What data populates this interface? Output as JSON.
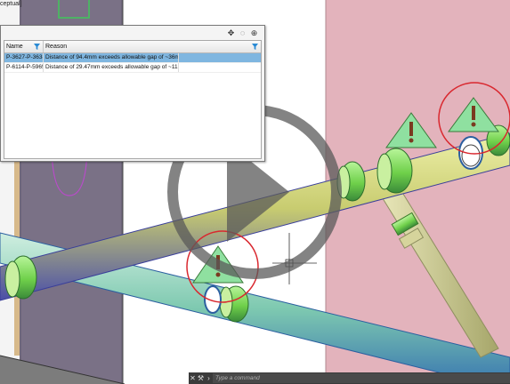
{
  "viewport": {
    "view_label": "ceptual]"
  },
  "panel": {
    "toolbar_icons": [
      "move-icon",
      "lasso-icon",
      "zoom-icon"
    ],
    "columns": [
      "Name",
      "Reason"
    ],
    "rows": [
      {
        "name": "P-3627-P-3638",
        "reason": "Distance of 94.4mm exceeds allowable gap of ~36mm"
      },
      {
        "name": "P-6114-P-5965",
        "reason": "Distance of 29.47mm exceeds allowable gap of ~11mm"
      }
    ]
  },
  "command_line": {
    "placeholder": "Type a command"
  },
  "colors": {
    "selection": "#7fb6e0",
    "wall_pink": "#e3b3bc",
    "pipe_green": "#7ed957",
    "warning_green": "#8fe0a0",
    "ring_red": "#d9282f"
  }
}
